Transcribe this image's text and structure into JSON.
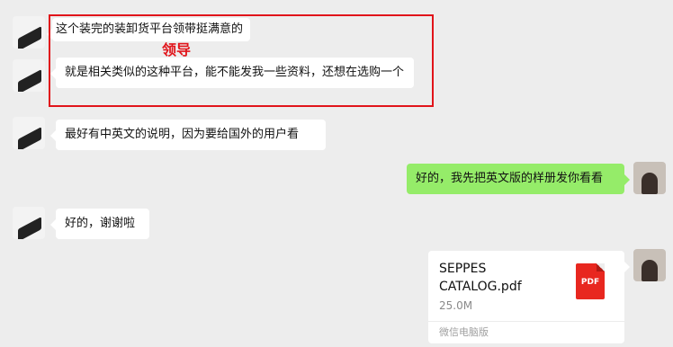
{
  "messages": [
    {
      "side": "left",
      "text": "这个装完的装卸货平台领带挺满意的"
    },
    {
      "side": "left",
      "text": "就是相关类似的这种平台，能不能发我一些资料，还想在选购一个"
    },
    {
      "side": "left",
      "text": "最好有中英文的说明，因为要给国外的用户看"
    },
    {
      "side": "right",
      "text": "好的，我先把英文版的样册发你看看"
    },
    {
      "side": "left",
      "text": "好的，谢谢啦"
    }
  ],
  "annotation": {
    "label": "领导",
    "color": "#e1141a"
  },
  "file": {
    "name": "SEPPES CATALOG.pdf",
    "size": "25.0M",
    "source": "微信电脑版",
    "icon": "pdf-icon",
    "icon_label": "PDF"
  },
  "colors": {
    "background": "#ededed",
    "incoming": "#ffffff",
    "outgoing": "#95ec69",
    "pdf": "#e8271f"
  }
}
